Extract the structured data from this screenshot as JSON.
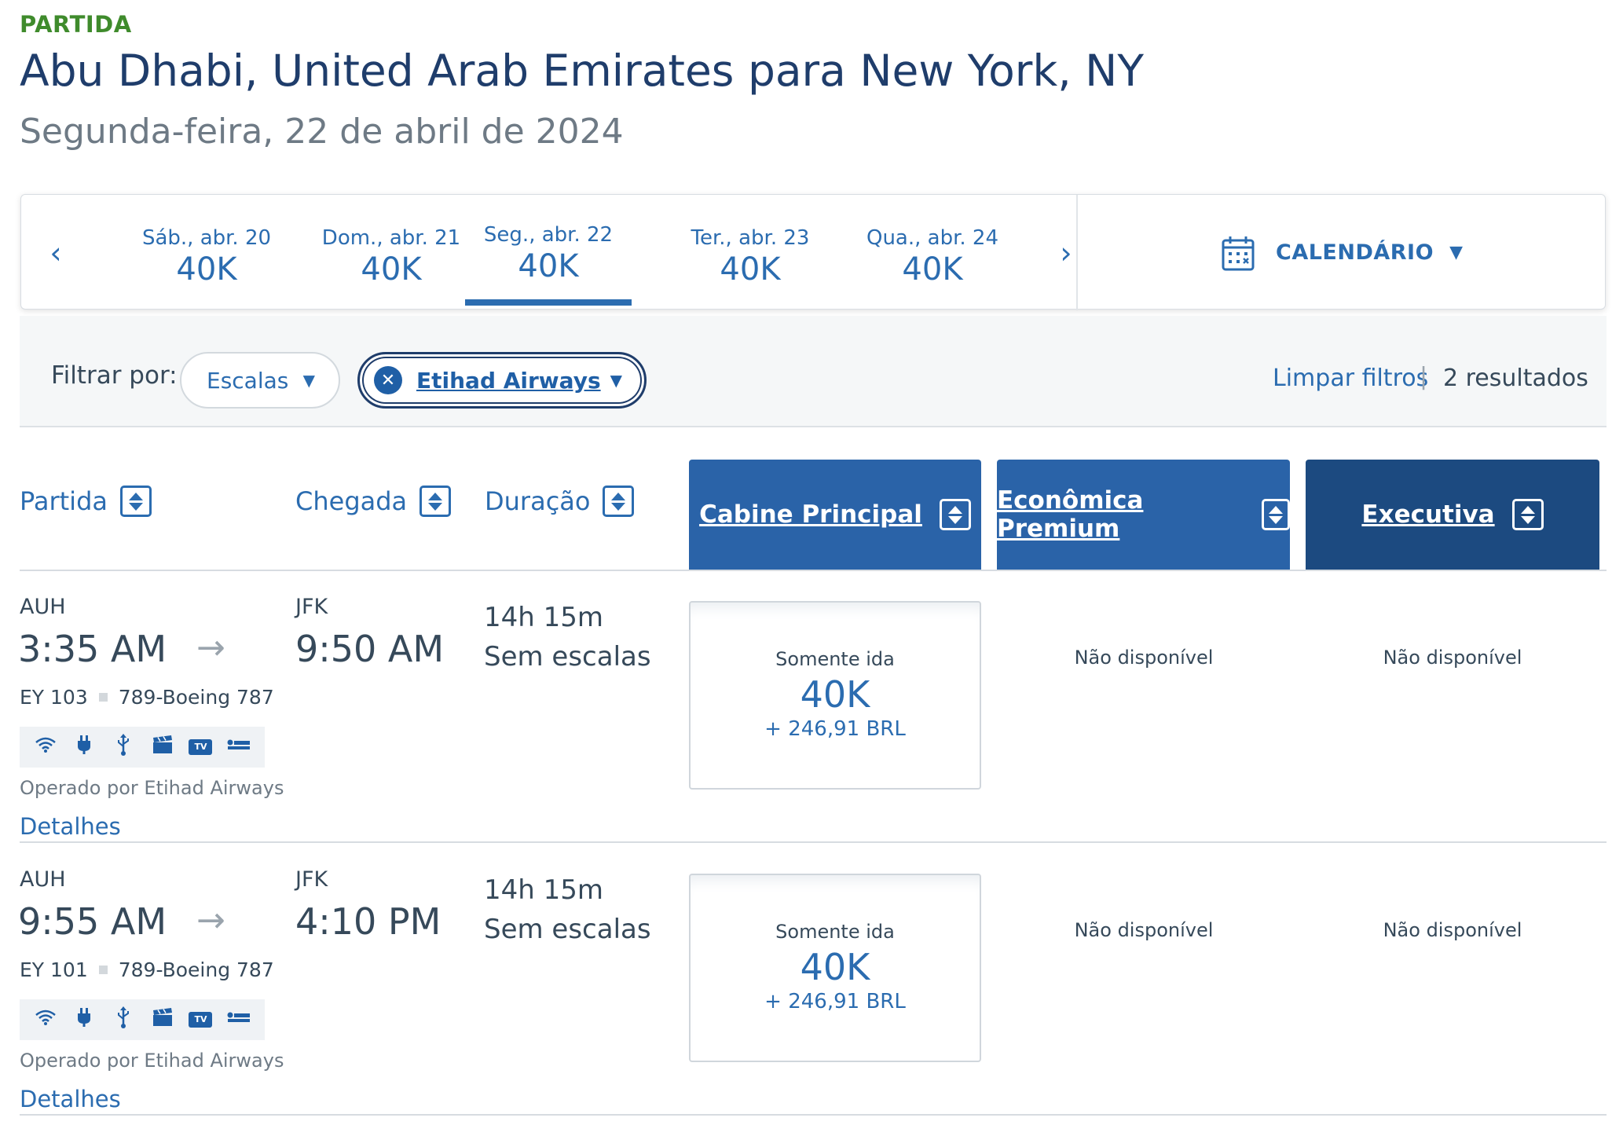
{
  "header": {
    "label": "PARTIDA",
    "route": "Abu Dhabi, United Arab Emirates para New York, NY",
    "date": "Segunda-feira, 22 de abril de 2024"
  },
  "date_bar": {
    "prev": "‹",
    "next": "›",
    "dates": [
      {
        "label": "Sáb., abr. 20",
        "price": "40K"
      },
      {
        "label": "Dom., abr. 21",
        "price": "40K"
      },
      {
        "label": "Seg., abr. 22",
        "price": "40K"
      },
      {
        "label": "Ter., abr. 23",
        "price": "40K"
      },
      {
        "label": "Qua., abr. 24",
        "price": "40K"
      }
    ],
    "selected_index": 2,
    "calendar_label": "CALENDÁRIO"
  },
  "filters": {
    "label": "Filtrar por:",
    "stops": "Escalas",
    "airline": "Etihad Airways",
    "clear": "Limpar filtros",
    "separator": "|",
    "results": "2 resultados"
  },
  "columns": {
    "departure": "Partida",
    "arrival": "Chegada",
    "duration": "Duração",
    "cabins": [
      "Cabine Principal",
      "Econômica Premium",
      "Executiva"
    ]
  },
  "colors": {
    "accent": "#2b6cb0",
    "cabin_main": "#2a63a8",
    "cabin_business": "#1c4a80",
    "label_green": "#3f8b2c"
  },
  "amenity_icons": [
    "wifi-icon",
    "power-outlet-icon",
    "usb-icon",
    "entertainment-icon",
    "tv-icon",
    "lie-flat-seat-icon"
  ],
  "flights": [
    {
      "from": "AUH",
      "depart_time": "3:35 AM",
      "to": "JFK",
      "arrive_time": "9:50 AM",
      "duration": "14h 15m",
      "stops": "Sem escalas",
      "flight_number": "EY 103",
      "aircraft": "789-Boeing 787",
      "operated_by": "Operado por Etihad Airways",
      "details": "Detalhes",
      "fare": {
        "label": "Somente ida",
        "price": "40K",
        "tax": "+ 246,91 BRL"
      },
      "premium": "Não disponível",
      "business": "Não disponível"
    },
    {
      "from": "AUH",
      "depart_time": "9:55 AM",
      "to": "JFK",
      "arrive_time": "4:10 PM",
      "duration": "14h 15m",
      "stops": "Sem escalas",
      "flight_number": "EY 101",
      "aircraft": "789-Boeing 787",
      "operated_by": "Operado por Etihad Airways",
      "details": "Detalhes",
      "fare": {
        "label": "Somente ida",
        "price": "40K",
        "tax": "+ 246,91 BRL"
      },
      "premium": "Não disponível",
      "business": "Não disponível"
    }
  ]
}
